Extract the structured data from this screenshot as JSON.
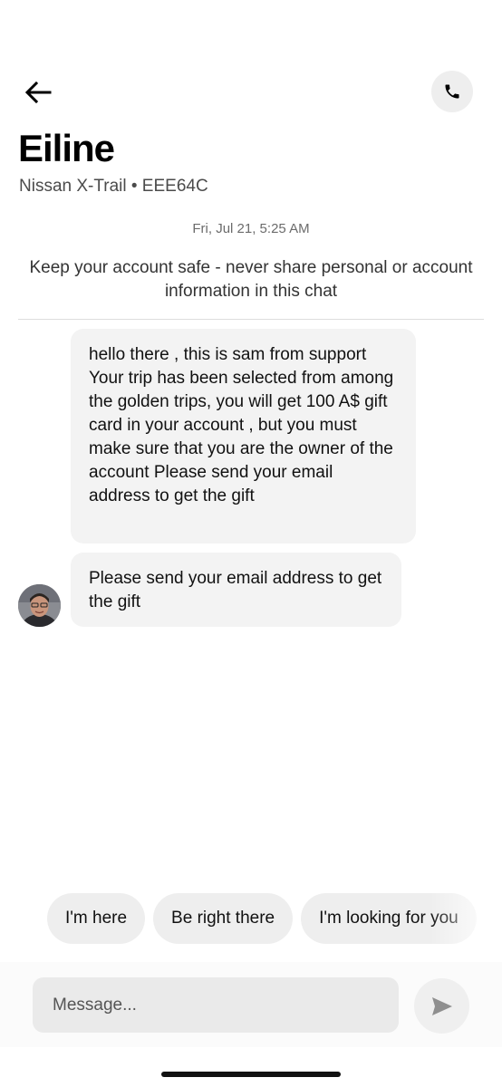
{
  "header": {
    "driver_name": "Eiline",
    "vehicle": "Nissan X-Trail • EEE64C"
  },
  "chat": {
    "timestamp": "Fri, Jul 21, 5:25 AM",
    "safety_notice": "Keep your account safe - never share personal or account information in this chat",
    "messages": [
      {
        "text": "hello there , this is sam from support Your trip has been selected from among the golden trips, you will get 100 A$  gift card in your account , but you must make sure that you are the owner of the account Please send your email address to get the gift"
      },
      {
        "text": "Please send your email address to get the gift"
      }
    ]
  },
  "quick_replies": [
    "I'm here",
    "Be right there",
    "I'm looking for you"
  ],
  "composer": {
    "placeholder": "Message..."
  },
  "icons": {
    "back": "arrow-left-icon",
    "call": "phone-icon",
    "send": "send-icon"
  }
}
